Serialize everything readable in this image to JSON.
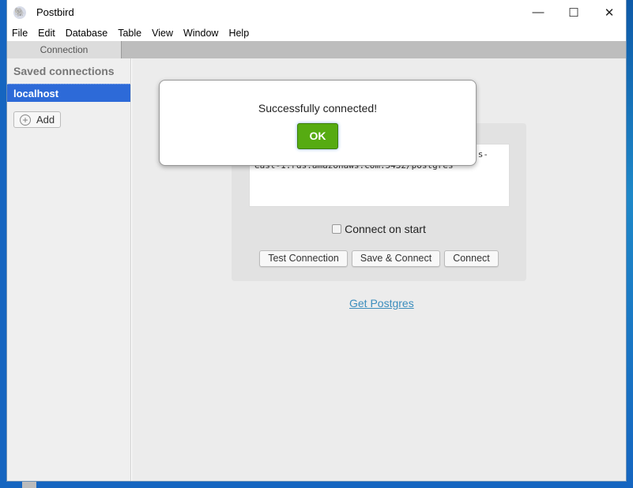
{
  "window": {
    "title": "Postbird",
    "app_icon": "elephant-icon"
  },
  "menu": [
    "File",
    "Edit",
    "Database",
    "Table",
    "View",
    "Window",
    "Help"
  ],
  "tabs": [
    {
      "label": "Connection",
      "active": true
    }
  ],
  "sidebar": {
    "heading": "Saved connections",
    "items": [
      {
        "label": "localhost",
        "selected": true
      }
    ],
    "add_label": "Add"
  },
  "form": {
    "url_line1": "s-",
    "url_line2": "east-1.rds.amazonaws.com:5432/postgres",
    "connect_on_start_label": "Connect on start",
    "connect_on_start": false,
    "buttons": [
      "Test Connection",
      "Save & Connect",
      "Connect"
    ]
  },
  "link": "Get Postgres",
  "modal": {
    "message": "Successfully connected!",
    "ok_label": "OK"
  },
  "colors": {
    "selected": "#2d6ad8",
    "ok": "#56ab12",
    "link": "#3b8dbd"
  }
}
